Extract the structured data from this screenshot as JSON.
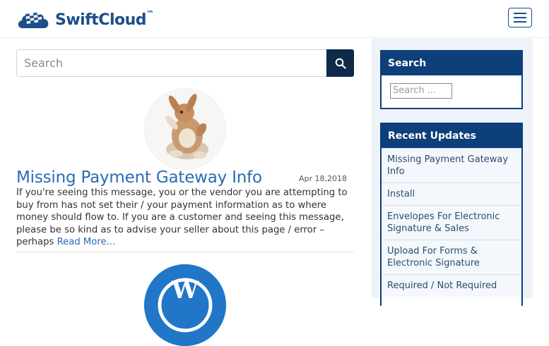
{
  "brand": {
    "name": "SwiftCloud",
    "tm": "™"
  },
  "main_search": {
    "placeholder": "Search"
  },
  "post": {
    "title": "Missing Payment Gateway Info",
    "date": "Apr 18,2018",
    "excerpt": "If you're seeing this message, you or the vendor you are attempting to buy from has not set their / your payment information as to where money should flow to. If you are a customer and seeing this message, please be so kind as to advise your seller about this page / error – perhaps ",
    "read_more": "Read More..."
  },
  "sidebar": {
    "search_widget": {
      "title": "Search",
      "placeholder": "Search ..."
    },
    "updates_widget": {
      "title": "Recent Updates",
      "items": [
        "Missing Payment Gateway Info",
        "Install",
        "Envelopes For Electronic Signature & Sales",
        "Upload For Forms & Electronic Signature",
        "Required / Not Required"
      ]
    }
  },
  "colors": {
    "brand": "#1b4f8a",
    "accent": "#0d3f7a",
    "link": "#2a6bb5"
  },
  "icons": {
    "menu": "hamburger-icon",
    "search": "search-icon",
    "logo": "cloud-flag-icon"
  }
}
